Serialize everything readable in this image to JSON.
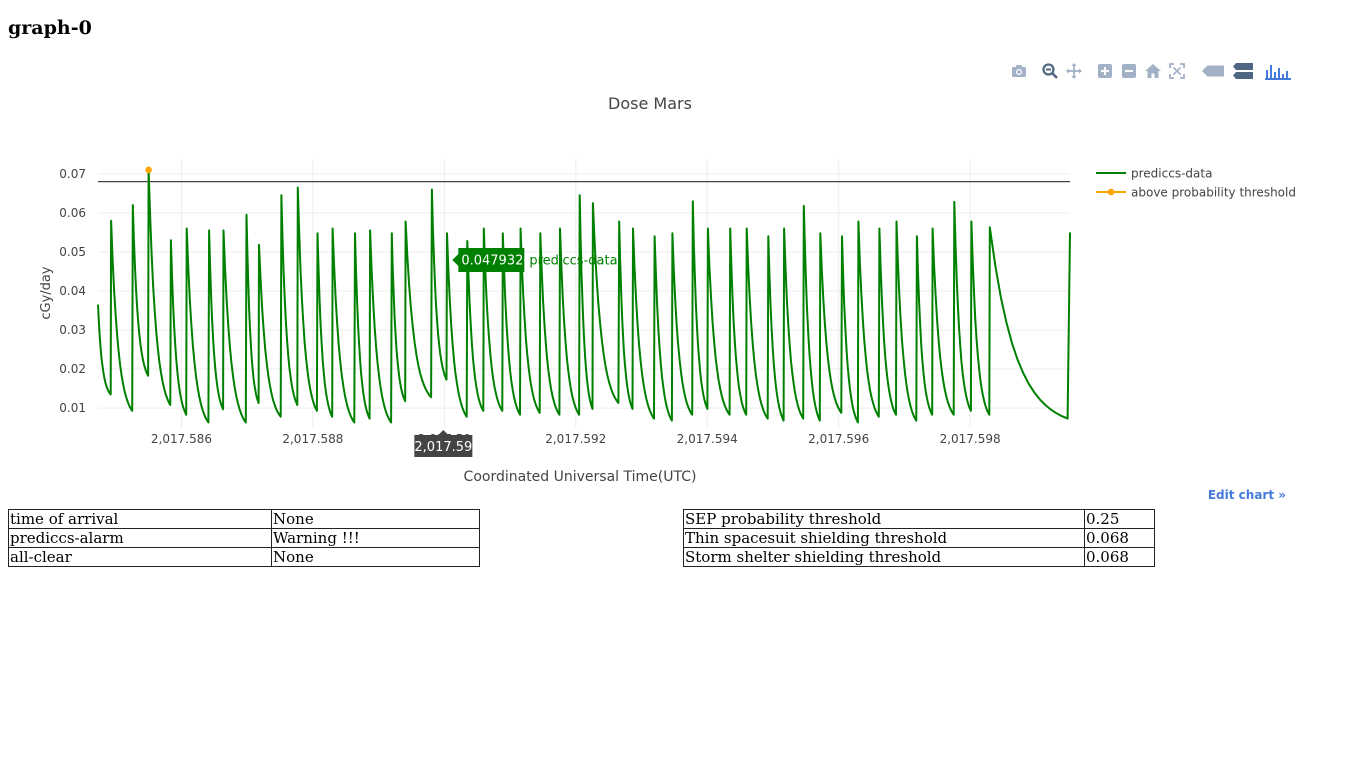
{
  "page": {
    "heading": "graph-0"
  },
  "modebar": {
    "buttons": [
      {
        "name": "camera-icon",
        "active": false
      },
      {
        "name": "zoom-icon",
        "active": false
      },
      {
        "name": "pan-icon",
        "active": false
      },
      {
        "name": "zoom-in-icon",
        "active": false
      },
      {
        "name": "zoom-out-icon",
        "active": false
      },
      {
        "name": "home-icon",
        "active": false
      },
      {
        "name": "autoscale-icon",
        "active": false
      },
      {
        "name": "hover-closest-icon",
        "active": false
      },
      {
        "name": "hover-compare-icon",
        "active": false
      },
      {
        "name": "plotly-logo-icon",
        "active": false
      }
    ],
    "colors": {
      "icon": "#a3b1c6",
      "logo": "#447adb"
    }
  },
  "chart_data": {
    "type": "line",
    "title": "Dose Mars",
    "xlabel": "Coordinated Universal Time(UTC)",
    "ylabel": "cGy/day",
    "xlim": [
      2017.58473,
      2017.59952
    ],
    "ylim": [
      0.0049,
      0.0738
    ],
    "x_ticks": [
      2017.586,
      2017.588,
      2017.59,
      2017.592,
      2017.594,
      2017.596,
      2017.598
    ],
    "x_tick_labels": [
      "2,017.586",
      "2,017.588",
      "2,017.59",
      "2,017.592",
      "2,017.594",
      "2,017.596",
      "2,017.598"
    ],
    "y_ticks": [
      0.01,
      0.02,
      0.03,
      0.04,
      0.05,
      0.06,
      0.07
    ],
    "y_tick_labels": [
      "0.01",
      "0.02",
      "0.03",
      "0.04",
      "0.05",
      "0.06",
      "0.07"
    ],
    "grid": true,
    "legend": "top-right",
    "threshold": {
      "value": 0.068,
      "color": "#444444"
    },
    "series": [
      {
        "name": "prediccs-data",
        "color": "#008000",
        "peaks": [
          [
            2017.58473,
            0.0365,
            0.0135
          ],
          [
            2017.58493,
            0.058,
            0.0093
          ],
          [
            2017.58526,
            0.062,
            0.0183
          ],
          [
            2017.5855,
            0.071,
            0.0108
          ],
          [
            2017.58584,
            0.053,
            0.0083
          ],
          [
            2017.58608,
            0.056,
            0.0063
          ],
          [
            2017.58642,
            0.0555,
            0.0097
          ],
          [
            2017.58664,
            0.0555,
            0.0063
          ],
          [
            2017.58699,
            0.0595,
            0.0113
          ],
          [
            2017.58718,
            0.0518,
            0.0078
          ],
          [
            2017.58752,
            0.0645,
            0.0108
          ],
          [
            2017.58777,
            0.0665,
            0.0093
          ],
          [
            2017.58807,
            0.0548,
            0.0078
          ],
          [
            2017.5883,
            0.056,
            0.0063
          ],
          [
            2017.58864,
            0.0548,
            0.0073
          ],
          [
            2017.58887,
            0.0555,
            0.0063
          ],
          [
            2017.5892,
            0.0548,
            0.0118
          ],
          [
            2017.58941,
            0.0578,
            0.0128
          ],
          [
            2017.58981,
            0.066,
            0.0173
          ],
          [
            2017.59004,
            0.0548,
            0.0078
          ],
          [
            2017.59035,
            0.0528,
            0.0093
          ],
          [
            2017.5906,
            0.056,
            0.0093
          ],
          [
            2017.59089,
            0.0548,
            0.0083
          ],
          [
            2017.59116,
            0.056,
            0.0088
          ],
          [
            2017.59146,
            0.0548,
            0.0083
          ],
          [
            2017.59176,
            0.056,
            0.0083
          ],
          [
            2017.59206,
            0.0645,
            0.0098
          ],
          [
            2017.59226,
            0.0625,
            0.0113
          ],
          [
            2017.59266,
            0.0578,
            0.0098
          ],
          [
            2017.59287,
            0.056,
            0.0073
          ],
          [
            2017.5932,
            0.054,
            0.0068
          ],
          [
            2017.59347,
            0.0548,
            0.0083
          ],
          [
            2017.59378,
            0.063,
            0.0098
          ],
          [
            2017.59401,
            0.056,
            0.0083
          ],
          [
            2017.59435,
            0.056,
            0.0083
          ],
          [
            2017.5946,
            0.056,
            0.0073
          ],
          [
            2017.59493,
            0.054,
            0.0068
          ],
          [
            2017.59517,
            0.056,
            0.0073
          ],
          [
            2017.59547,
            0.0618,
            0.0068
          ],
          [
            2017.59572,
            0.0548,
            0.0088
          ],
          [
            2017.59605,
            0.054,
            0.0063
          ],
          [
            2017.5963,
            0.0578,
            0.0078
          ],
          [
            2017.59662,
            0.056,
            0.0083
          ],
          [
            2017.59688,
            0.0578,
            0.0068
          ],
          [
            2017.59719,
            0.054,
            0.0083
          ],
          [
            2017.59743,
            0.056,
            0.0083
          ],
          [
            2017.59776,
            0.0628,
            0.0093
          ],
          [
            2017.59802,
            0.0578,
            0.0083
          ],
          [
            2017.5983,
            0.0563,
            0.0073
          ],
          [
            2017.59952,
            0.055,
            0.055
          ]
        ]
      },
      {
        "name": "above probability threshold",
        "color": "#ffa500",
        "points": [
          [
            2017.5855,
            0.071
          ]
        ]
      }
    ],
    "hover": {
      "x_label": "2,017.59",
      "value_label": "0.0479326",
      "series_label": "prediccs-data",
      "x": 2017.59,
      "y": 0.0479326
    }
  },
  "edit_link": "Edit chart »",
  "status_table": [
    {
      "key": "time of arrival",
      "value": "None"
    },
    {
      "key": "prediccs-alarm",
      "value": "Warning !!!"
    },
    {
      "key": "all-clear",
      "value": "None"
    }
  ],
  "threshold_table": [
    {
      "key": "SEP probability threshold",
      "value": "0.25"
    },
    {
      "key": "Thin spacesuit shielding threshold",
      "value": "0.068"
    },
    {
      "key": "Storm shelter shielding threshold",
      "value": "0.068"
    }
  ]
}
